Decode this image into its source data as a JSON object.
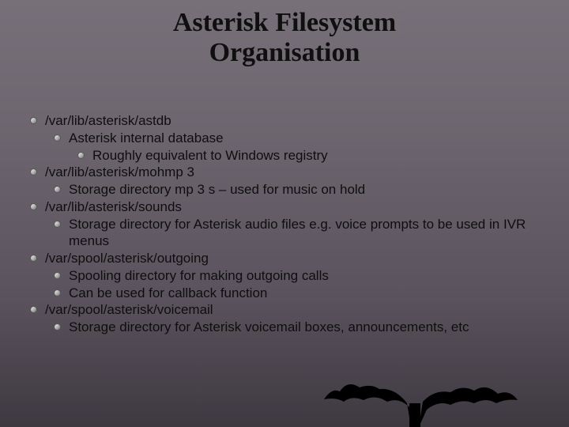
{
  "title_line1": "Asterisk Filesystem",
  "title_line2": "Organisation",
  "items": {
    "i0": "/var/lib/asterisk/astdb",
    "i0a": "Asterisk internal database",
    "i0b": "Roughly equivalent to Windows registry",
    "i1": "/var/lib/asterisk/mohmp 3",
    "i1a": "Storage directory mp 3 s – used for music on hold",
    "i2": "/var/lib/asterisk/sounds",
    "i2a": "Storage directory for Asterisk audio files e.g. voice prompts to be used in IVR menus",
    "i3": "/var/spool/asterisk/outgoing",
    "i3a": "Spooling directory for making outgoing calls",
    "i3b": "Can be used for callback function",
    "i4": "/var/spool/asterisk/voicemail",
    "i4a": "Storage directory for Asterisk voicemail boxes, announcements, etc"
  }
}
